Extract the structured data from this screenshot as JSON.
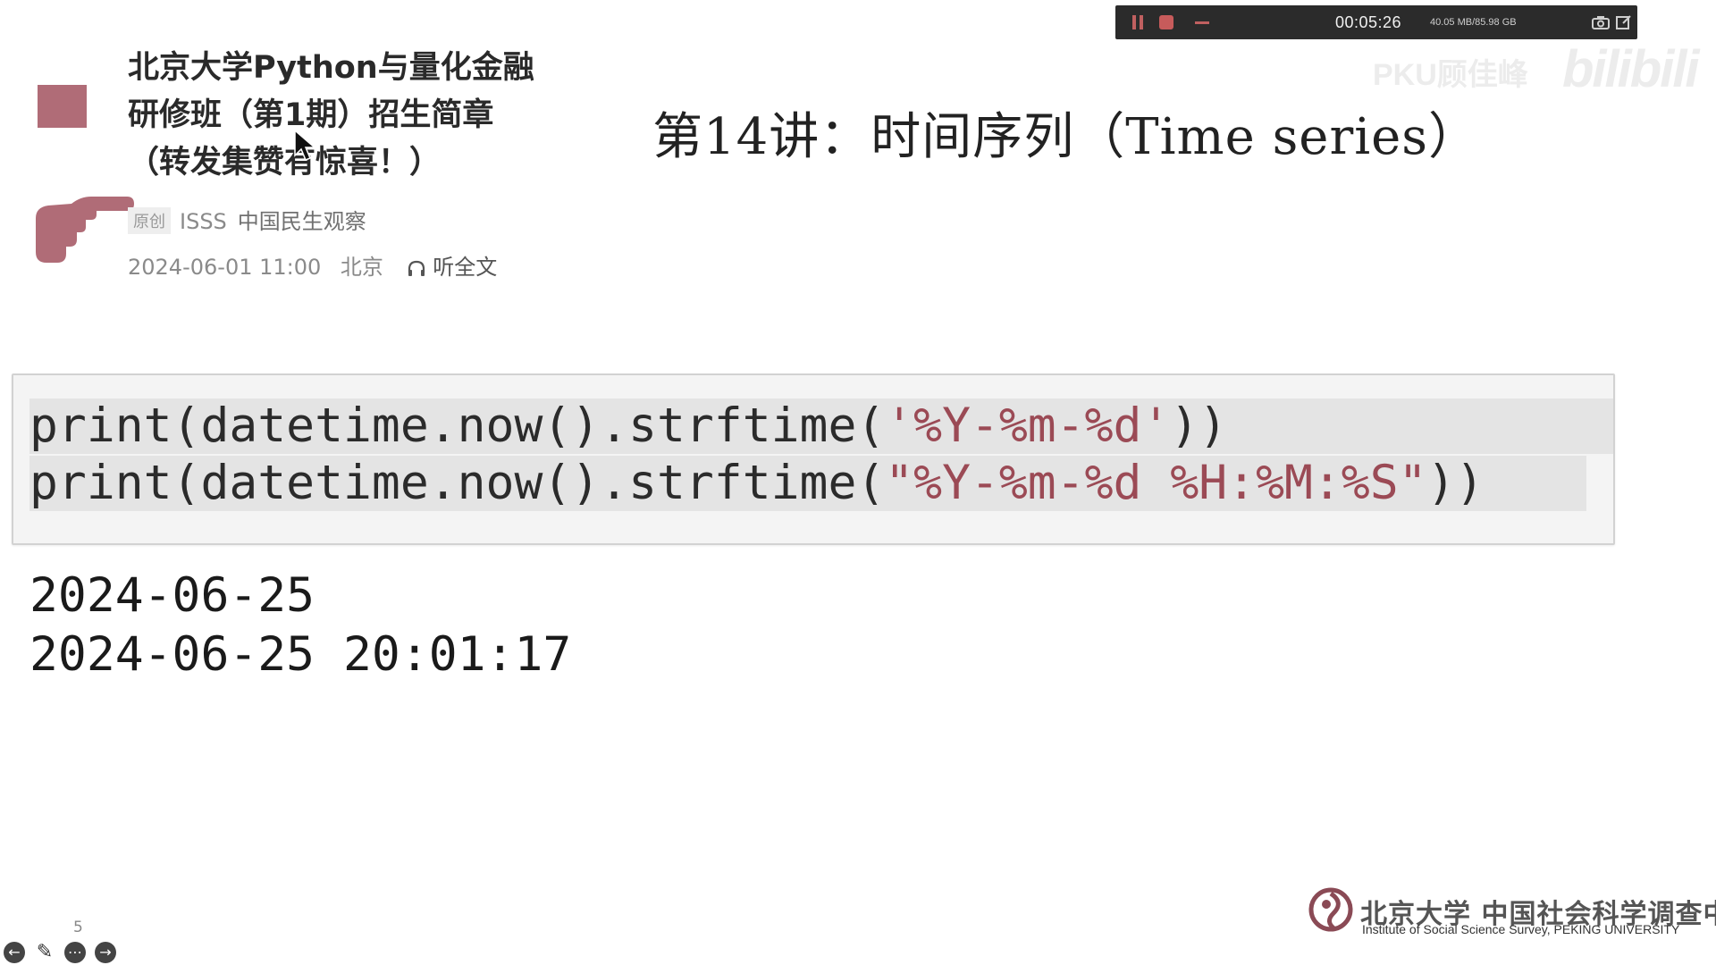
{
  "recorder": {
    "elapsed": "00:05:26",
    "storage": "40.05 MB/85.98 GB"
  },
  "watermark": {
    "uploader": "PKU顾佳峰",
    "platform": "bilibili"
  },
  "article": {
    "title_lines": [
      "北京大学Python与量化金融",
      "研修班（第1期）招生简章",
      "（转发集赞有惊喜！）"
    ],
    "badge": "原创",
    "author": "ISSS",
    "source": "中国民生观察",
    "date": "2024-06-01 11:00",
    "location": "北京",
    "listen_label": "听全文"
  },
  "lecture": {
    "title": "第14讲：时间序列（Time series）"
  },
  "code": {
    "line1_prefix": "print(datetime.now().strftime(",
    "line1_string": "'%Y-%m-%d'",
    "line1_suffix": "))",
    "line2_prefix": "print(datetime.now().strftime(",
    "line2_string": "\"%Y-%m-%d %H:%M:%S\"",
    "line2_suffix": "))"
  },
  "output": {
    "line1": "2024-06-25",
    "line2": "2024-06-25 20:01:17"
  },
  "footer": {
    "page_number": "5",
    "institute_cn": "北京大学 中国社会科学调查中心",
    "institute_en": "Institute of Social Science Survey, PEKING UNIVERSITY"
  },
  "colors": {
    "accent": "#b06c77",
    "string": "#9b4a55",
    "recorder_bg": "#2b2b2b"
  }
}
